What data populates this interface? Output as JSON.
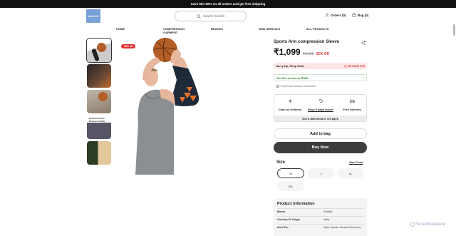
{
  "promo": "Save Min 50% on all orders and get free shipping",
  "header": {
    "logo": "Snic Kit",
    "search_placeholder": "Search Snickfit",
    "orders": "Orders (0)",
    "bag": "Bag (0)"
  },
  "nav": [
    "HOME",
    "COMPRESSION GARMENT",
    "BRACES",
    "NEW ARRIVALS",
    "ALL PRODUCTS"
  ],
  "thumbs": {
    "t4_text": "Workout Smart Recover All Day"
  },
  "product": {
    "discount_badge": "52% off",
    "title": "Sports Arm compression Sleeve",
    "price": "₹1,099",
    "mrp": "₹2,299",
    "off": "52% Off",
    "hurry": "Hurry Up, Shop Now!",
    "timer": "◷ 00H 52M 07S",
    "deal": "Get this as low as ₹935",
    "tax": "Final Price Inclusive of all taxes",
    "features": [
      "Cash on Delivery",
      "Easy 5 days return",
      "Free Delivery"
    ],
    "delivery": "Get it delivered in 4-9 days",
    "add_to_bag": "Add to bag",
    "buy_now": "Buy Now"
  },
  "size": {
    "label": "Size",
    "chart": "Size Chart",
    "options": [
      "M",
      "L",
      "XL",
      "2XL"
    ],
    "selected": "M"
  },
  "pinfo": {
    "title": "Product Information",
    "rows": [
      {
        "k": "Brand",
        "v": "Snickfit"
      },
      {
        "k": "Country Of Origin",
        "v": "India"
      },
      {
        "k": "Ideal For",
        "v": "Gym, Sports, Muscle Recovery"
      }
    ]
  },
  "watermark": "ScanMalware",
  "colors": {
    "accent": "#e23232",
    "dark_button": "#3d3d3d",
    "green": "#2b8a2b"
  }
}
